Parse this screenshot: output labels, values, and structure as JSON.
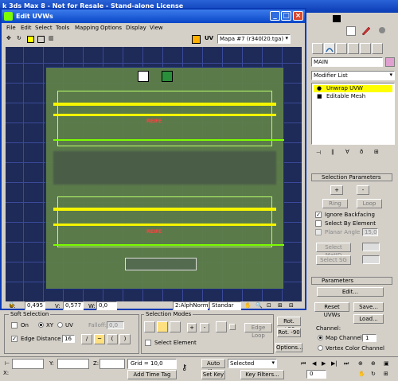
{
  "main_window": {
    "title": "k 3ds Max 8  -  Not for Resale - Stand-alone License"
  },
  "uv_editor": {
    "title": "Edit UVWs",
    "menu": [
      "File",
      "Edit",
      "Select",
      "Tools",
      "Mapping",
      "Options",
      "Display",
      "View"
    ],
    "uv_label": "UV",
    "map_dropdown": "Mapa #7 (r340l20.tga)",
    "canvas_text_1": "REIFE",
    "canvas_text_2": "REIFE",
    "u_label": "U:",
    "u_value": "0,495",
    "v_label": "V:",
    "v_value": "0,577",
    "w_label": "W:",
    "w_value": "0,0",
    "channel_dropdown": "2:AlphNorm",
    "standard_dropdown": "Standar",
    "lock_icon": "lock-icon"
  },
  "right_panel": {
    "object_name": "MAIN",
    "modifier_list": "Modifier List",
    "stack": [
      "Unwrap UVW",
      "Editable Mesh"
    ],
    "selection_params": {
      "header": "Selection Parameters",
      "plus": "+",
      "minus": "-",
      "ring": "Ring",
      "loop": "Loop",
      "ignore_backfacing": "Ignore Backfacing",
      "select_by_element": "Select By Element",
      "planar_angle": "Planar Angle",
      "planar_angle_value": "15,0",
      "select_matid": "Select MatID",
      "select_sg": "Select SG"
    },
    "parameters": {
      "header": "Parameters",
      "edit": "Edit...",
      "reset_uvws": "Reset UVWs",
      "save": "Save...",
      "load": "Load...",
      "channel": "Channel:",
      "map_channel": "Map Channel:",
      "map_channel_value": "1",
      "vertex_color_channel": "Vertex Color Channel"
    }
  },
  "bottom_tools": {
    "soft_selection": "Soft Selection",
    "on": "On",
    "xy": "XY",
    "uv": "UV",
    "falloff": "Falloff:",
    "falloff_value": "0,0",
    "edge_distance": "Edge Distance",
    "edge_distance_value": "16",
    "selection_modes": "Selection Modes",
    "select_element": "Select Element",
    "edge_loop": "Edge Loop",
    "rot_plus": "Rot. +90",
    "rot_minus": "Rot. -90",
    "options": "Options..."
  },
  "status_bar": {
    "x_label": "X:",
    "y_label": "Y:",
    "z_label": "Z:",
    "grid": "Grid = 10,0",
    "auto_key": "Auto Key",
    "selected": "Selected",
    "set_key": "Set Key",
    "key_filters": "Key Filters...",
    "add_time_tag": "Add Time Tag",
    "frame_value": "0"
  },
  "colors": {
    "accent": "#0a3bb4",
    "uv_canvas_bg": "#1e2a57",
    "highlight_yellow": "#f5f500",
    "selection_green": "#7cfc00"
  }
}
